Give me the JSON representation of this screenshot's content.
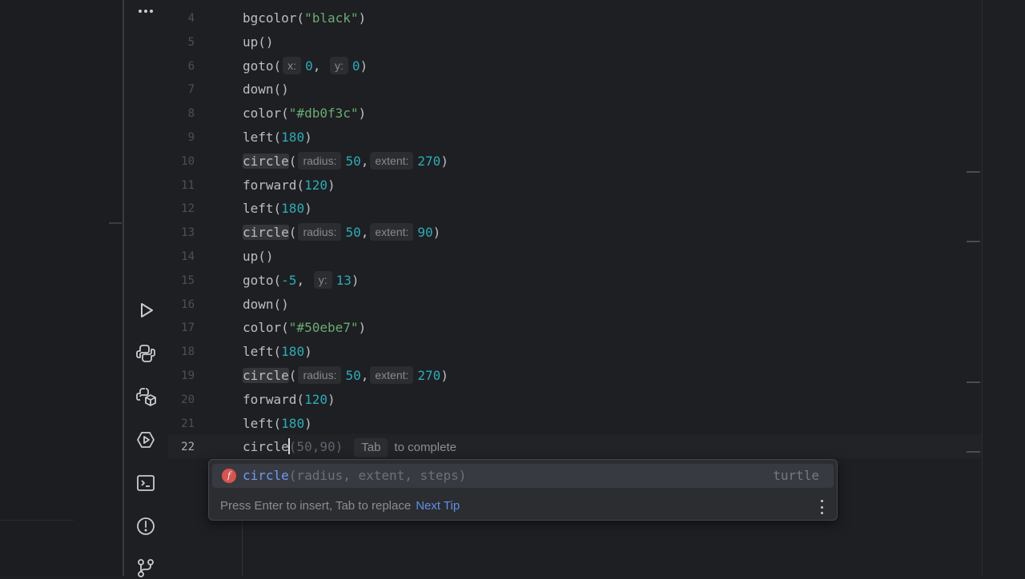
{
  "sidebar": {
    "tools": [
      {
        "name": "more-tool-windows-icon",
        "top": 0
      },
      {
        "name": "run-icon"
      },
      {
        "name": "python-console-icon"
      },
      {
        "name": "python-packages-icon"
      },
      {
        "name": "services-icon"
      },
      {
        "name": "terminal-icon"
      },
      {
        "name": "problems-icon"
      },
      {
        "name": "version-control-icon"
      }
    ]
  },
  "editor": {
    "current_line": 22,
    "lines": [
      {
        "n": "4",
        "tokens": [
          {
            "t": "bgcolor("
          },
          {
            "t": "\"black\"",
            "c": "str"
          },
          {
            "t": ")"
          }
        ]
      },
      {
        "n": "5",
        "tokens": [
          {
            "t": "up()"
          }
        ]
      },
      {
        "n": "6",
        "tokens": [
          {
            "t": "goto("
          },
          {
            "hint": "x:"
          },
          {
            "t": "0",
            "c": "num"
          },
          {
            "t": ", "
          },
          {
            "hint": "y:"
          },
          {
            "t": "0",
            "c": "num"
          },
          {
            "t": ")"
          }
        ]
      },
      {
        "n": "7",
        "tokens": [
          {
            "t": "down()"
          }
        ]
      },
      {
        "n": "8",
        "tokens": [
          {
            "t": "color("
          },
          {
            "t": "\"#db0f3c\"",
            "c": "str"
          },
          {
            "t": ")"
          }
        ]
      },
      {
        "n": "9",
        "tokens": [
          {
            "t": "left("
          },
          {
            "t": "180",
            "c": "num"
          },
          {
            "t": ")"
          }
        ]
      },
      {
        "n": "10",
        "tokens": [
          {
            "t": "circle",
            "c": "hl"
          },
          {
            "t": "("
          },
          {
            "hint": "radius:"
          },
          {
            "t": "50",
            "c": "num"
          },
          {
            "t": ","
          },
          {
            "hint": "extent:"
          },
          {
            "t": "270",
            "c": "num"
          },
          {
            "t": ")"
          }
        ]
      },
      {
        "n": "11",
        "tokens": [
          {
            "t": "forward("
          },
          {
            "t": "120",
            "c": "num"
          },
          {
            "t": ")"
          }
        ]
      },
      {
        "n": "12",
        "tokens": [
          {
            "t": "left("
          },
          {
            "t": "180",
            "c": "num"
          },
          {
            "t": ")"
          }
        ]
      },
      {
        "n": "13",
        "tokens": [
          {
            "t": "circle",
            "c": "hl"
          },
          {
            "t": "("
          },
          {
            "hint": "radius:"
          },
          {
            "t": "50",
            "c": "num"
          },
          {
            "t": ","
          },
          {
            "hint": "extent:"
          },
          {
            "t": "90",
            "c": "num"
          },
          {
            "t": ")"
          }
        ]
      },
      {
        "n": "14",
        "tokens": [
          {
            "t": "up()"
          }
        ]
      },
      {
        "n": "15",
        "tokens": [
          {
            "t": "goto("
          },
          {
            "t": "-5",
            "c": "num"
          },
          {
            "t": ", "
          },
          {
            "hint": "y:"
          },
          {
            "t": "13",
            "c": "num"
          },
          {
            "t": ")"
          }
        ]
      },
      {
        "n": "16",
        "tokens": [
          {
            "t": "down()"
          }
        ]
      },
      {
        "n": "17",
        "tokens": [
          {
            "t": "color("
          },
          {
            "t": "\"#50ebe7\"",
            "c": "str"
          },
          {
            "t": ")"
          }
        ]
      },
      {
        "n": "18",
        "tokens": [
          {
            "t": "left("
          },
          {
            "t": "180",
            "c": "num"
          },
          {
            "t": ")"
          }
        ]
      },
      {
        "n": "19",
        "tokens": [
          {
            "t": "circle",
            "c": "hl"
          },
          {
            "t": "("
          },
          {
            "hint": "radius:"
          },
          {
            "t": "50",
            "c": "num"
          },
          {
            "t": ","
          },
          {
            "hint": "extent:"
          },
          {
            "t": "270",
            "c": "num"
          },
          {
            "t": ")"
          }
        ]
      },
      {
        "n": "20",
        "tokens": [
          {
            "t": "forward("
          },
          {
            "t": "120",
            "c": "num"
          },
          {
            "t": ")"
          }
        ]
      },
      {
        "n": "21",
        "tokens": [
          {
            "t": "left("
          },
          {
            "t": "180",
            "c": "num"
          },
          {
            "t": ")"
          }
        ]
      },
      {
        "n": "22",
        "tokens": [
          {
            "t": "circle"
          },
          {
            "cursor": true
          },
          {
            "t": "(50,90)",
            "c": "ghost"
          },
          {
            "tab": "Tab"
          },
          {
            "tabtext": "to complete"
          }
        ]
      }
    ]
  },
  "completion": {
    "kind_badge": "f",
    "name": "circle",
    "params": "(radius, extent, steps)",
    "module": "turtle",
    "footer": "Press Enter to insert, Tab to replace",
    "next_tip": "Next Tip"
  },
  "colors": {
    "background": "#1e1f22",
    "string": "#6aab73",
    "number": "#2aacb8",
    "accent": "#5e8fe8"
  }
}
